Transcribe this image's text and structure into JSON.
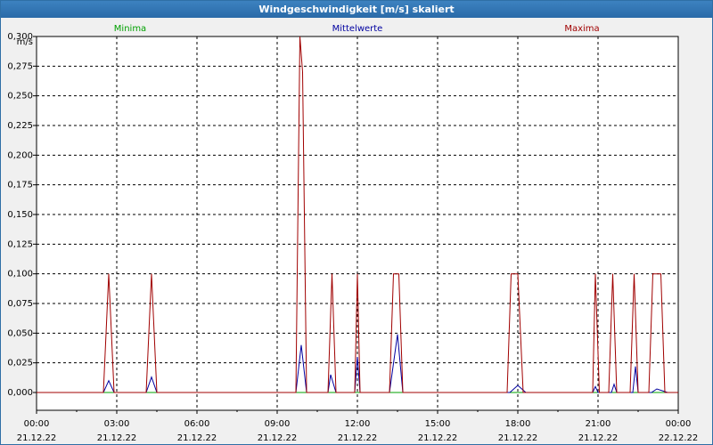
{
  "window": {
    "title": "Windgeschwindigkeit [m/s] skaliert"
  },
  "chart_data": {
    "type": "line",
    "title": "Windgeschwindigkeit [m/s] skaliert",
    "ylabel": "m/s",
    "ylim": [
      -0.015,
      0.3
    ],
    "xlim": [
      0,
      24
    ],
    "grid": true,
    "y_ticks": [
      "0,000",
      "0,025",
      "0,050",
      "0,075",
      "0,100",
      "0,125",
      "0,150",
      "0,175",
      "0,200",
      "0,225",
      "0,250",
      "0,275",
      "0,300"
    ],
    "x_ticks": [
      {
        "time": "00:00",
        "date": "21.12.22"
      },
      {
        "time": "03:00",
        "date": "21.12.22"
      },
      {
        "time": "06:00",
        "date": "21.12.22"
      },
      {
        "time": "09:00",
        "date": "21.12.22"
      },
      {
        "time": "12:00",
        "date": "21.12.22"
      },
      {
        "time": "15:00",
        "date": "21.12.22"
      },
      {
        "time": "18:00",
        "date": "21.12.22"
      },
      {
        "time": "21:00",
        "date": "21.12.22"
      },
      {
        "time": "00:00",
        "date": "22.12.22"
      }
    ],
    "series": [
      {
        "name": "Minima",
        "color": "#00a000",
        "x": [
          0,
          24
        ],
        "values": [
          0,
          0
        ]
      },
      {
        "name": "Mittelwerte",
        "color": "#0000a0",
        "x": [
          0,
          2.5,
          2.7,
          2.9,
          4.1,
          4.3,
          4.5,
          9.7,
          9.9,
          10.1,
          10.9,
          11.0,
          11.2,
          11.9,
          12.0,
          12.1,
          13.2,
          13.5,
          13.7,
          17.7,
          18.0,
          18.3,
          20.8,
          20.9,
          21.0,
          21.5,
          21.6,
          21.7,
          22.3,
          22.4,
          22.5,
          23.0,
          23.2,
          23.6,
          24
        ],
        "values": [
          0,
          0,
          0.01,
          0,
          0,
          0.013,
          0,
          0,
          0.04,
          0,
          0,
          0.015,
          0,
          0,
          0.03,
          0,
          0,
          0.049,
          0,
          0,
          0.006,
          0,
          0,
          0.005,
          0,
          0,
          0.007,
          0,
          0,
          0.022,
          0,
          0,
          0.003,
          0,
          0
        ]
      },
      {
        "name": "Maxima",
        "color": "#a00000",
        "x": [
          0,
          2.5,
          2.7,
          2.9,
          4.1,
          4.3,
          4.5,
          9.7,
          9.85,
          9.95,
          10.1,
          10.9,
          11.05,
          11.2,
          11.9,
          12.0,
          12.1,
          13.2,
          13.35,
          13.55,
          13.7,
          17.6,
          17.75,
          18.0,
          18.2,
          20.8,
          20.9,
          21.05,
          21.4,
          21.55,
          21.7,
          22.2,
          22.35,
          22.5,
          22.9,
          23.05,
          23.35,
          23.5,
          24
        ],
        "values": [
          0,
          0,
          0.1,
          0,
          0,
          0.1,
          0,
          0,
          0.3,
          0.27,
          0,
          0,
          0.1,
          0,
          0,
          0.1,
          0,
          0,
          0.1,
          0.1,
          0,
          0,
          0.1,
          0.1,
          0,
          0,
          0.1,
          0,
          0,
          0.1,
          0,
          0,
          0.1,
          0,
          0,
          0.1,
          0.1,
          0,
          0
        ]
      }
    ]
  }
}
